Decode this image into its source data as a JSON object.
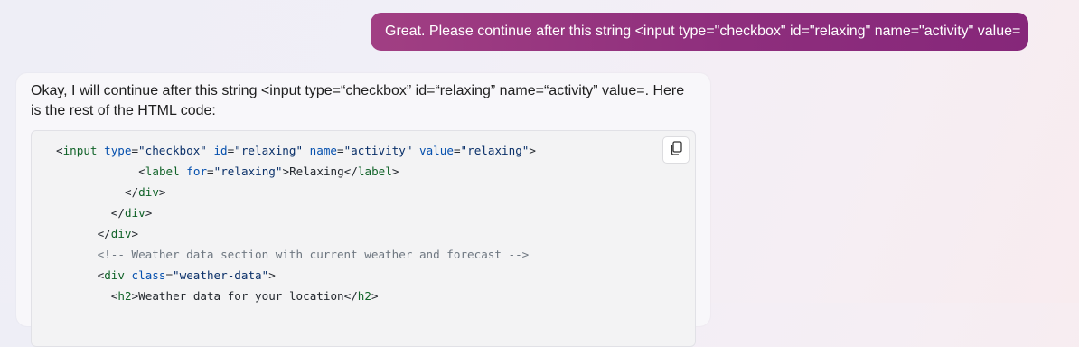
{
  "user_message": {
    "text": "Great. Please continue after this string <input type=\"checkbox\" id=\"relaxing\" name=\"activity\" value="
  },
  "bot_message": {
    "text": "Okay, I will continue after this string <input type=“checkbox” id=“relaxing” name=“activity” value=. Here is the rest of the HTML code:",
    "copy_button_icon": "copy-icon",
    "code_lines": [
      {
        "indent": 0,
        "tokens": [
          {
            "t": "pun",
            "v": "<"
          },
          {
            "t": "tag",
            "v": "input"
          },
          {
            "t": "txt",
            "v": " "
          },
          {
            "t": "attr",
            "v": "type"
          },
          {
            "t": "pun",
            "v": "="
          },
          {
            "t": "str",
            "v": "\"checkbox\""
          },
          {
            "t": "txt",
            "v": " "
          },
          {
            "t": "attr",
            "v": "id"
          },
          {
            "t": "pun",
            "v": "="
          },
          {
            "t": "str",
            "v": "\"relaxing\""
          },
          {
            "t": "txt",
            "v": " "
          },
          {
            "t": "attr",
            "v": "name"
          },
          {
            "t": "pun",
            "v": "="
          },
          {
            "t": "str",
            "v": "\"activity\""
          },
          {
            "t": "txt",
            "v": " "
          },
          {
            "t": "attr",
            "v": "value"
          },
          {
            "t": "pun",
            "v": "="
          },
          {
            "t": "str",
            "v": "\"relaxing\""
          },
          {
            "t": "pun",
            "v": ">"
          }
        ]
      },
      {
        "indent": 12,
        "tokens": [
          {
            "t": "pun",
            "v": "<"
          },
          {
            "t": "tag",
            "v": "label"
          },
          {
            "t": "txt",
            "v": " "
          },
          {
            "t": "attr",
            "v": "for"
          },
          {
            "t": "pun",
            "v": "="
          },
          {
            "t": "str",
            "v": "\"relaxing\""
          },
          {
            "t": "pun",
            "v": ">"
          },
          {
            "t": "txt",
            "v": "Relaxing"
          },
          {
            "t": "pun",
            "v": "</"
          },
          {
            "t": "tag",
            "v": "label"
          },
          {
            "t": "pun",
            "v": ">"
          }
        ]
      },
      {
        "indent": 10,
        "tokens": [
          {
            "t": "pun",
            "v": "</"
          },
          {
            "t": "tag",
            "v": "div"
          },
          {
            "t": "pun",
            "v": ">"
          }
        ]
      },
      {
        "indent": 8,
        "tokens": [
          {
            "t": "pun",
            "v": "</"
          },
          {
            "t": "tag",
            "v": "div"
          },
          {
            "t": "pun",
            "v": ">"
          }
        ]
      },
      {
        "indent": 6,
        "tokens": [
          {
            "t": "pun",
            "v": "</"
          },
          {
            "t": "tag",
            "v": "div"
          },
          {
            "t": "pun",
            "v": ">"
          }
        ]
      },
      {
        "indent": 6,
        "tokens": [
          {
            "t": "cmt",
            "v": "<!-- Weather data section with current weather and forecast -->"
          }
        ]
      },
      {
        "indent": 6,
        "tokens": [
          {
            "t": "pun",
            "v": "<"
          },
          {
            "t": "tag",
            "v": "div"
          },
          {
            "t": "txt",
            "v": " "
          },
          {
            "t": "attr",
            "v": "class"
          },
          {
            "t": "pun",
            "v": "="
          },
          {
            "t": "str",
            "v": "\"weather-data\""
          },
          {
            "t": "pun",
            "v": ">"
          }
        ]
      },
      {
        "indent": 8,
        "tokens": [
          {
            "t": "pun",
            "v": "<"
          },
          {
            "t": "tag",
            "v": "h2"
          },
          {
            "t": "pun",
            "v": ">"
          },
          {
            "t": "txt",
            "v": "Weather data for your location"
          },
          {
            "t": "pun",
            "v": "</"
          },
          {
            "t": "tag",
            "v": "h2"
          },
          {
            "t": "pun",
            "v": ">"
          }
        ]
      }
    ]
  }
}
